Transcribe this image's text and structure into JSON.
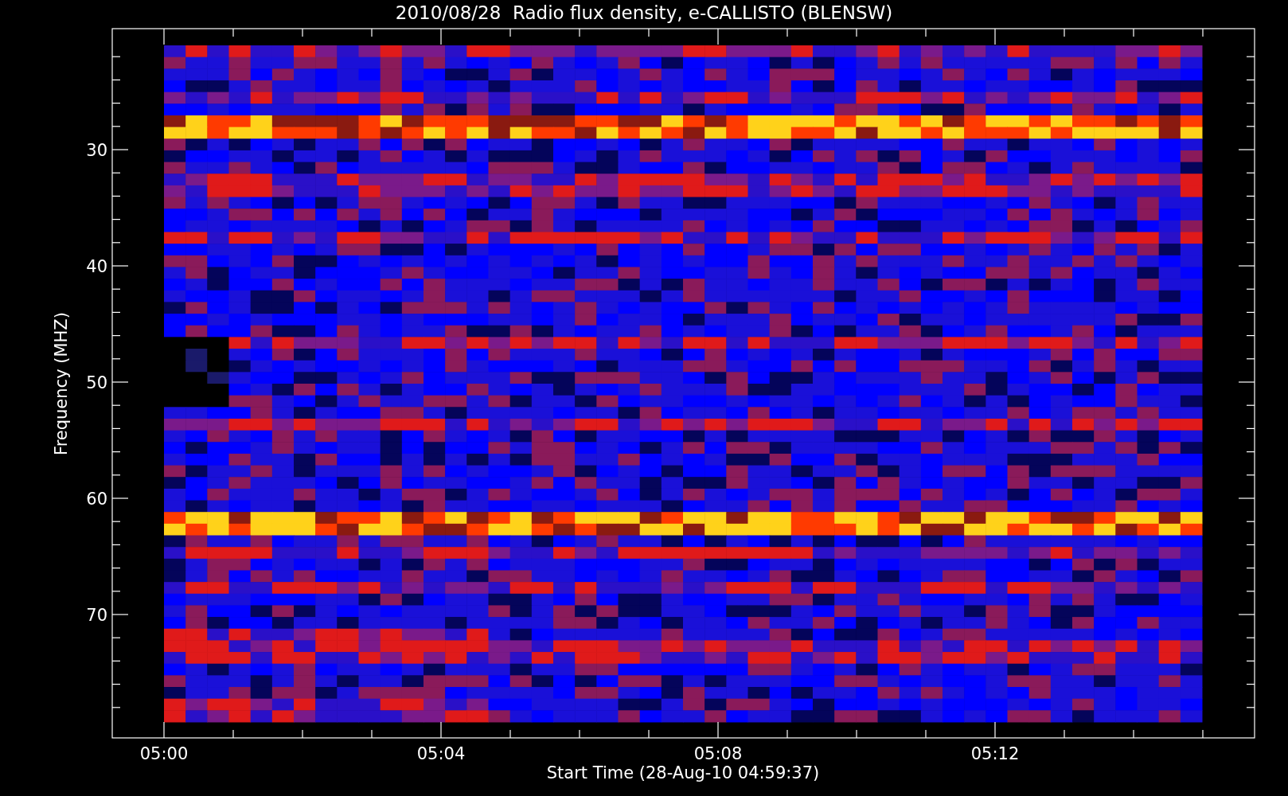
{
  "title": "2010/08/28  Radio flux density, e-CALLISTO (BLENSW)",
  "y_axis": {
    "label": "Frequency (MHZ)",
    "ticks": [
      "30",
      "40",
      "50",
      "60",
      "70"
    ]
  },
  "x_axis": {
    "label": "Start Time (28-Aug-10 04:59:37)",
    "ticks": [
      "05:00",
      "05:04",
      "05:08",
      "05:12"
    ]
  }
}
